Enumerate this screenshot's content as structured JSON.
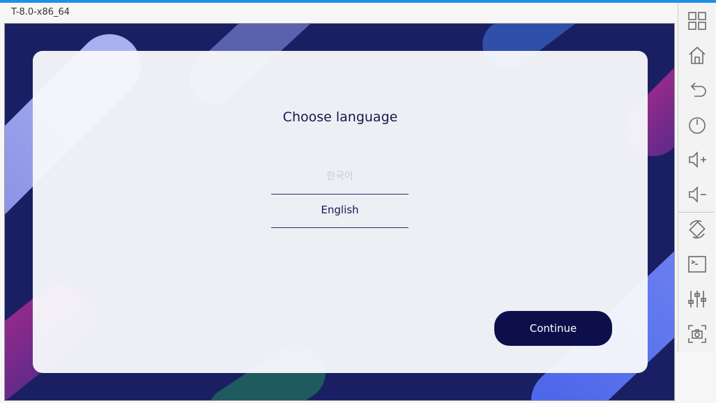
{
  "window": {
    "title": "T-8.0-x86_64"
  },
  "dialog": {
    "title": "Choose language",
    "options": [
      {
        "label": "한국어",
        "state": "unselected"
      },
      {
        "label": "English",
        "state": "selected"
      }
    ],
    "continue_label": "Continue"
  },
  "sidepanel": {
    "buttons": [
      {
        "icon": "grid-icon"
      },
      {
        "icon": "home-icon"
      },
      {
        "icon": "back-icon"
      },
      {
        "icon": "power-icon"
      },
      {
        "icon": "volume-up-icon"
      },
      {
        "icon": "volume-down-icon"
      },
      {
        "icon": "rotate-icon"
      },
      {
        "icon": "terminal-icon"
      },
      {
        "icon": "sliders-icon"
      },
      {
        "icon": "screenshot-icon"
      }
    ]
  },
  "colors": {
    "accent_bar": "#1e90e6",
    "background": "#1a1f63",
    "button": "#0c0f4a"
  }
}
